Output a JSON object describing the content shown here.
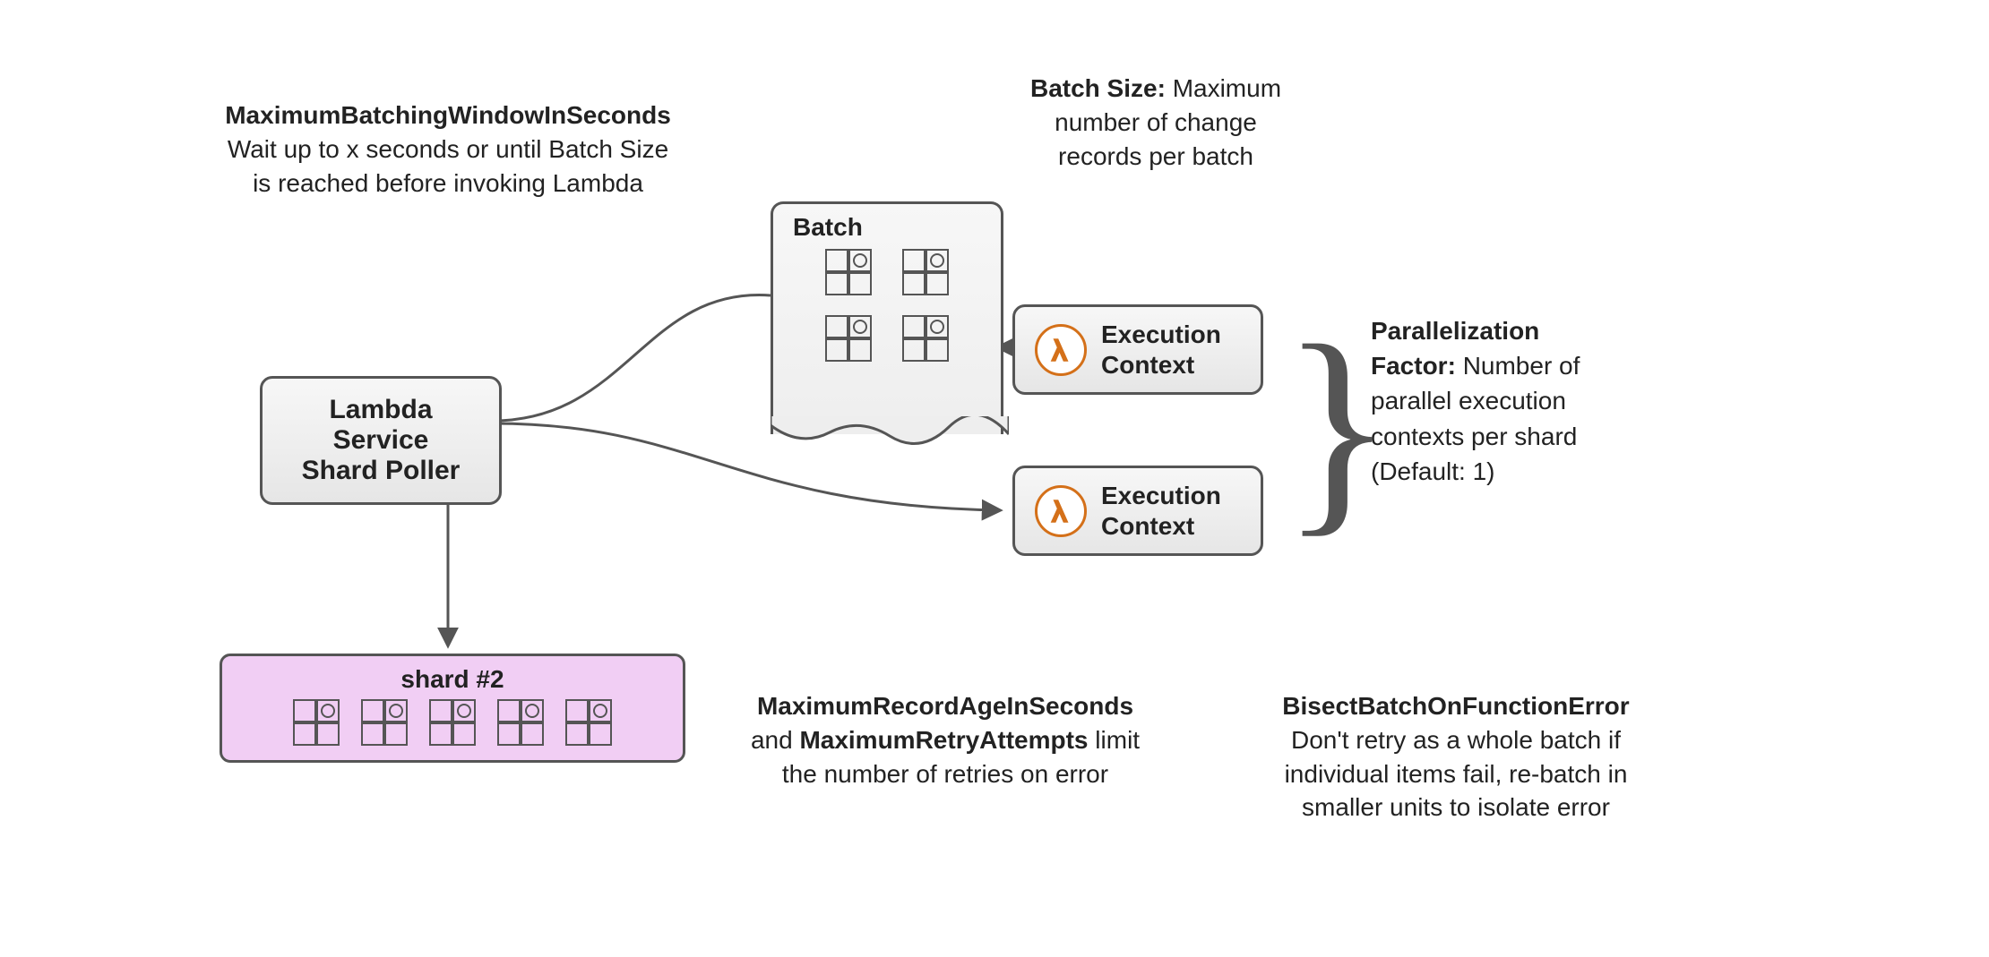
{
  "annotations": {
    "batchingWindow": {
      "title": "MaximumBatchingWindowInSeconds",
      "desc1": "Wait up to x seconds or until Batch Size",
      "desc2": "is reached before invoking Lambda"
    },
    "batchSize": {
      "title": "Batch Size:",
      "desc1": "Maximum",
      "desc2": "number of change",
      "desc3": "records per batch"
    },
    "parallelization": {
      "title": "Parallelization",
      "title2": "Factor:",
      "desc1": "Number of",
      "desc2": "parallel execution",
      "desc3": "contexts per shard",
      "desc4": "(Default: 1)"
    },
    "retries": {
      "title1": "MaximumRecordAgeInSeconds",
      "joiner": "and",
      "title2": "MaximumRetryAttempts",
      "desc1": "limit",
      "desc2": "the number of retries on error"
    },
    "bisect": {
      "title": "BisectBatchOnFunctionError",
      "desc1": "Don't retry as a whole batch if",
      "desc2": "individual items fail, re-batch in",
      "desc3": "smaller units to isolate error"
    }
  },
  "components": {
    "poller": {
      "line1": "Lambda Service",
      "line2": "Shard Poller"
    },
    "batch": {
      "label": "Batch"
    },
    "exec1": {
      "label": "Execution\nContext"
    },
    "exec2": {
      "label": "Execution\nContext"
    },
    "shard": {
      "label": "shard #2"
    }
  }
}
